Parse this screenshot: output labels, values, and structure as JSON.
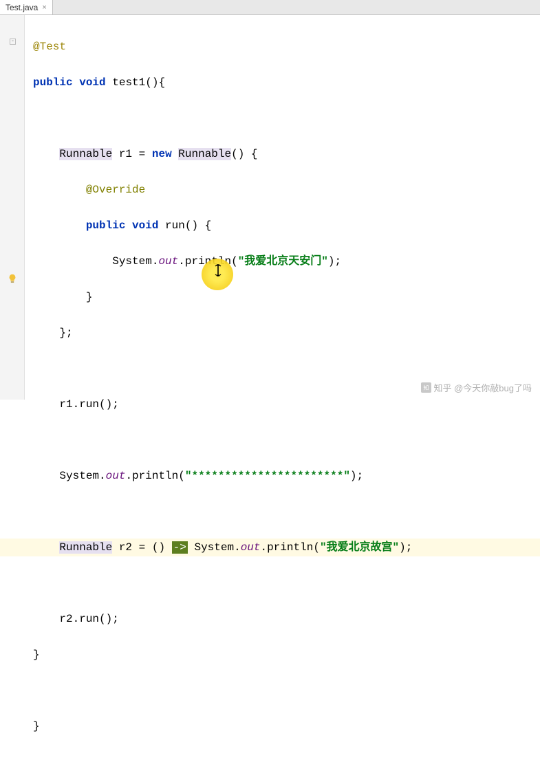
{
  "tab": {
    "label": "Test.java"
  },
  "code": {
    "annotation_test": "@Test",
    "kw_public": "public",
    "kw_void": "void",
    "kw_new": "new",
    "method_test1": "test1",
    "type_runnable": "Runnable",
    "var_r1": "r1",
    "var_r2": "r2",
    "annotation_override": "@Override",
    "method_run": "run",
    "cls_system": "System",
    "field_out": "out",
    "method_println": "println",
    "str1": "\"我爱北京天安门\"",
    "str2": "\"***********************\"",
    "str3": "\"我爱北京故宫\"",
    "call_r1run": "r1.run();",
    "call_r2run": "r2.run();",
    "arrow": "->"
  },
  "watermark": {
    "text": "知乎 @今天你敲bug了吗"
  }
}
